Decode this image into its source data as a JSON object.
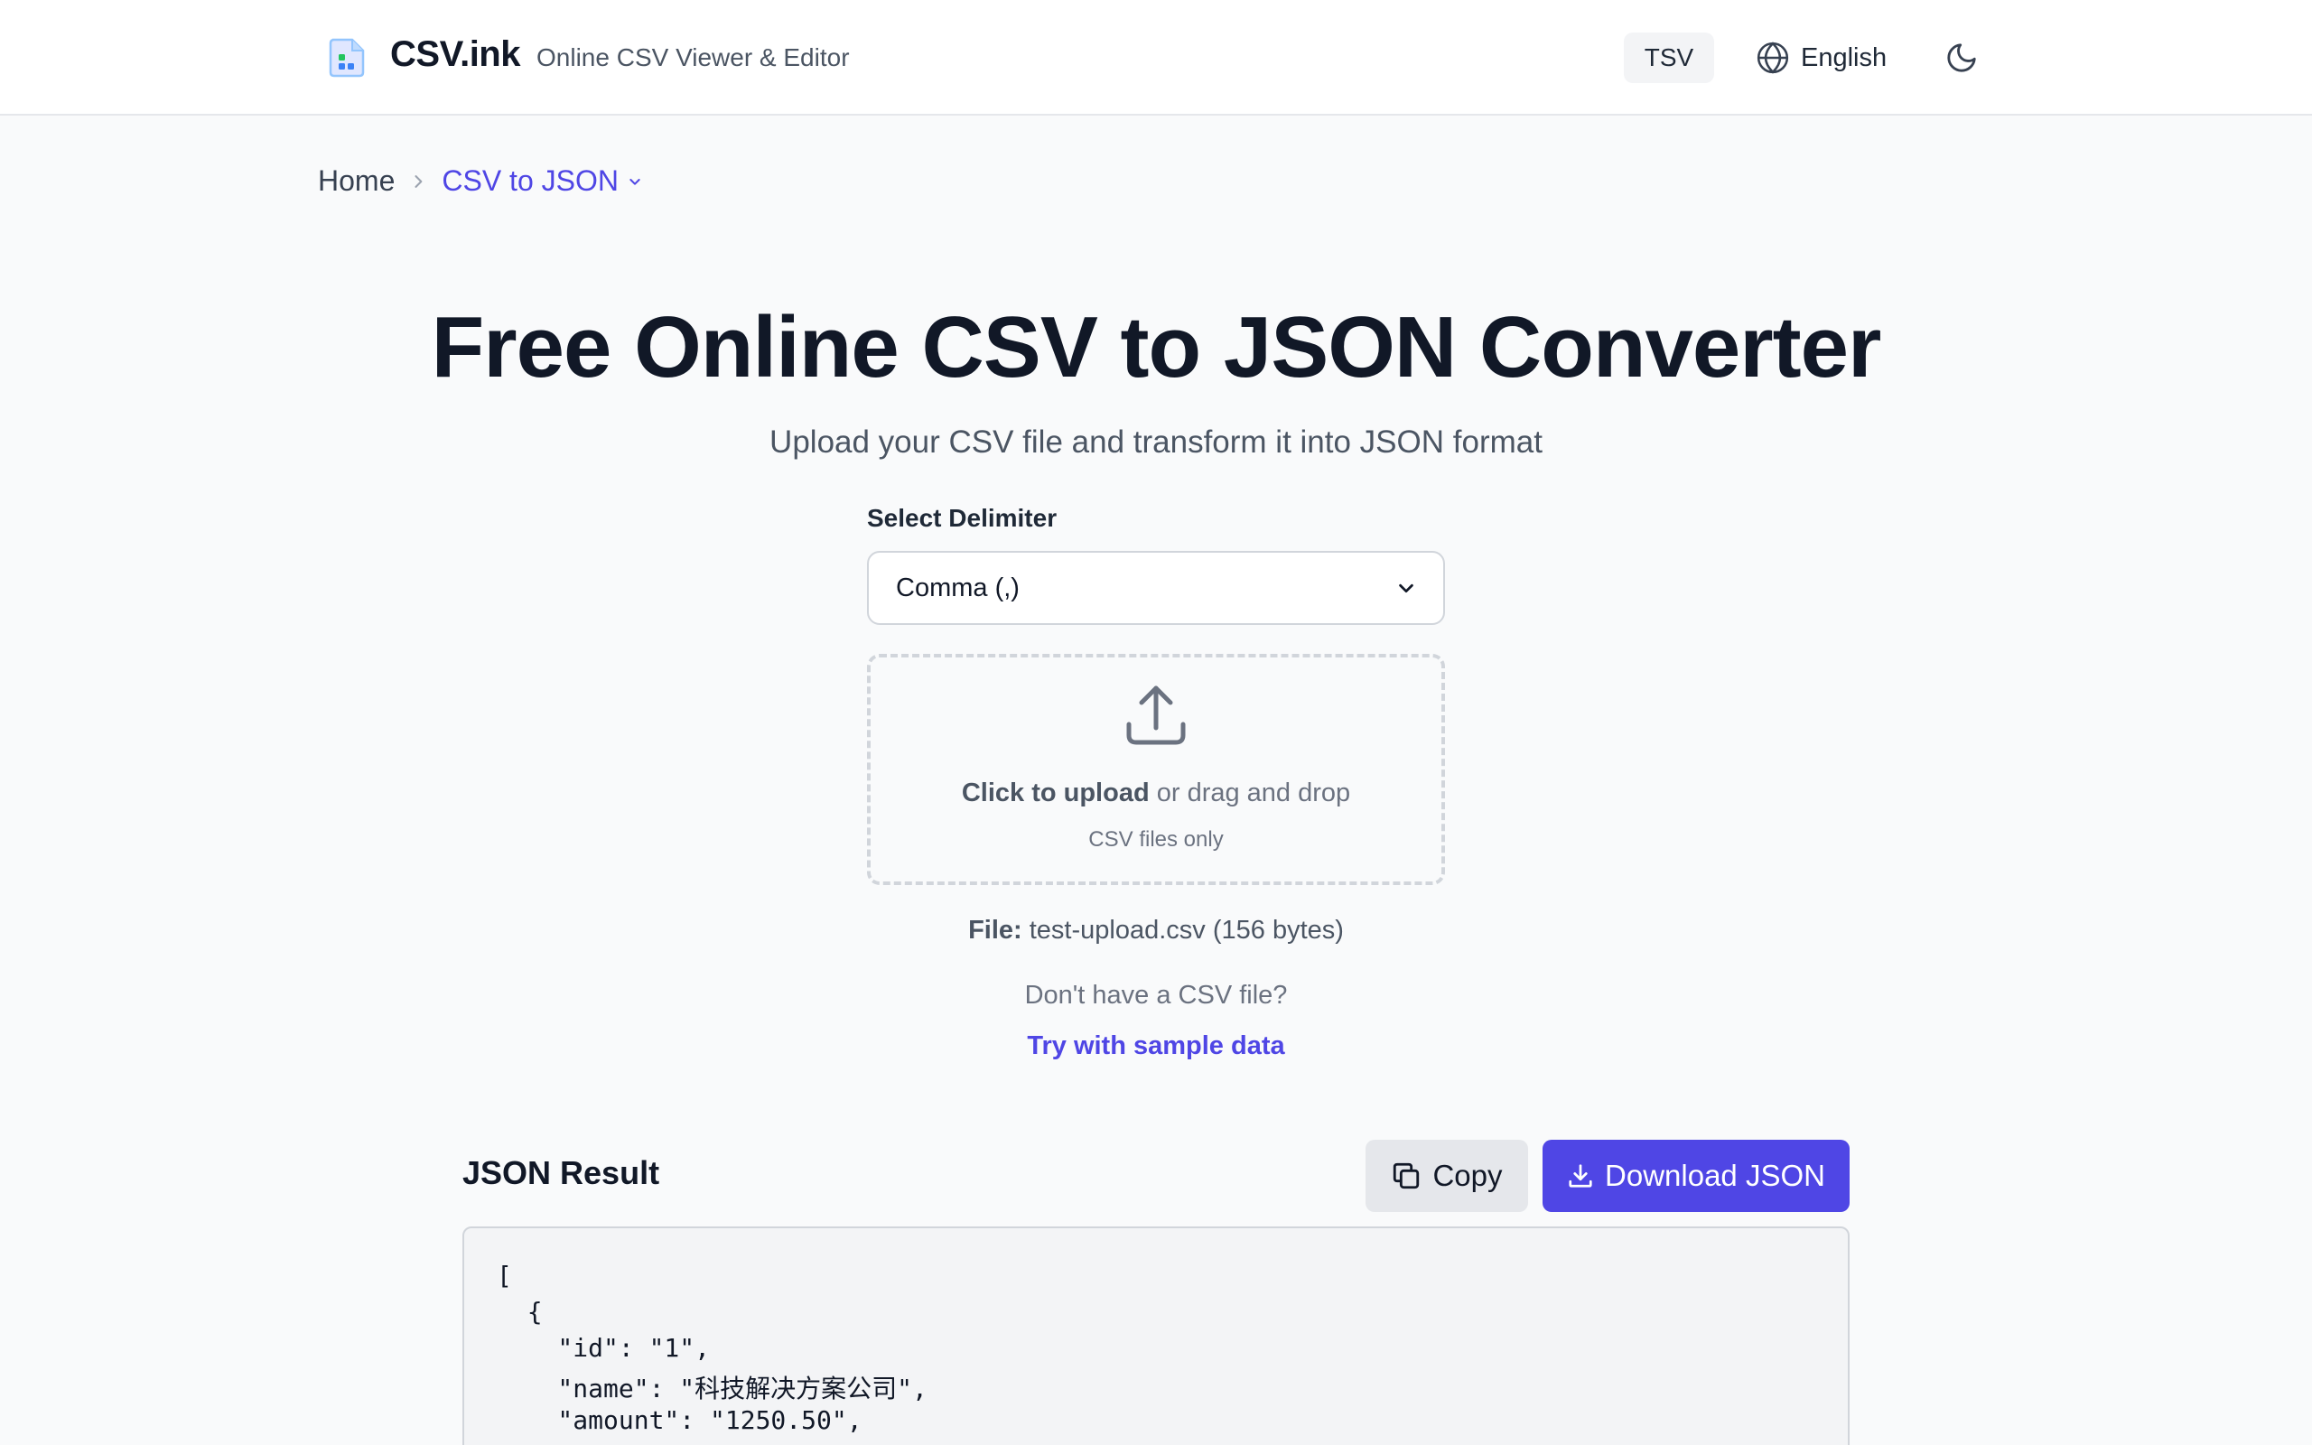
{
  "header": {
    "brand": "CSV.ink",
    "tagline": "Online CSV Viewer & Editor",
    "tsv_label": "TSV",
    "language_label": "English",
    "logo_icon": "spreadsheet-file-icon",
    "language_icon": "globe-icon",
    "theme_icon": "moon-icon"
  },
  "breadcrumb": {
    "home": "Home",
    "current": "CSV to JSON",
    "separator_icon": "chevron-right-icon",
    "dropdown_icon": "chevron-down-icon"
  },
  "hero": {
    "title": "Free Online CSV to JSON Converter",
    "subtitle": "Upload your CSV file and transform it into JSON format"
  },
  "delimiter": {
    "label": "Select Delimiter",
    "selected": "Comma (,)"
  },
  "dropzone": {
    "icon": "upload-icon",
    "click_text": "Click to upload",
    "rest_text": " or drag and drop",
    "sub_text": "CSV files only"
  },
  "file": {
    "label": "File:",
    "value": "test-upload.csv (156 bytes)"
  },
  "sample": {
    "prompt": "Don't have a CSV file?",
    "link": "Try with sample data"
  },
  "result": {
    "title": "JSON Result",
    "copy_label": "Copy",
    "download_label": "Download JSON",
    "code_lines": [
      "[",
      "  {",
      "    \"id\": \"1\",",
      "    \"name\": \"科技解决方案公司\",",
      "    \"amount\": \"1250.50\","
    ]
  },
  "colors": {
    "accent": "#4f46e5",
    "background": "#f9fafb",
    "header_bg": "#ffffff"
  }
}
